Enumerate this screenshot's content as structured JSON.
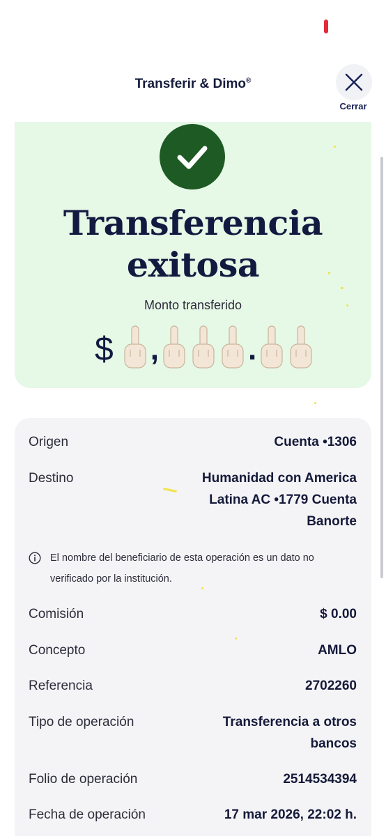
{
  "header": {
    "title": "Transferir & Dimo",
    "title_mark": "®",
    "close_label": "Cerrar"
  },
  "success": {
    "title_line1": "Transferencia",
    "title_line2": "exitosa",
    "amount_label": "Monto transferido",
    "amount_currency": "$",
    "amount_separator_thousands": ",",
    "amount_separator_decimal": ".",
    "amount_glyph": "middle-finger-emoji"
  },
  "details": {
    "origin": {
      "label": "Origen",
      "value": "Cuenta •1306"
    },
    "destination": {
      "label": "Destino",
      "value_line1": "Humanidad con America",
      "value_line2": "Latina AC •1779 Cuenta",
      "value_line3": "Banorte"
    },
    "notice": {
      "line1": "El nombre del beneficiario de esta operación es un dato no",
      "line2": "verificado por la institución."
    },
    "commission": {
      "label": "Comisión",
      "value": "$ 0.00"
    },
    "concept": {
      "label": "Concepto",
      "value": "AMLO"
    },
    "reference": {
      "label": "Referencia",
      "value": "2702260"
    },
    "operation_type": {
      "label": "Tipo de operación",
      "value_line1": "Transferencia a otros",
      "value_line2": "bancos"
    },
    "folio": {
      "label": "Folio de operación",
      "value": "2514534394"
    },
    "date": {
      "label": "Fecha de operación",
      "value": "17 mar 2026, 22:02 h."
    }
  },
  "colors": {
    "success_bg": "#e6f8e6",
    "check_green": "#1e5a23",
    "navy": "#121a40",
    "detail_bg": "#f4f4f6",
    "status_red": "#e32b3c"
  }
}
